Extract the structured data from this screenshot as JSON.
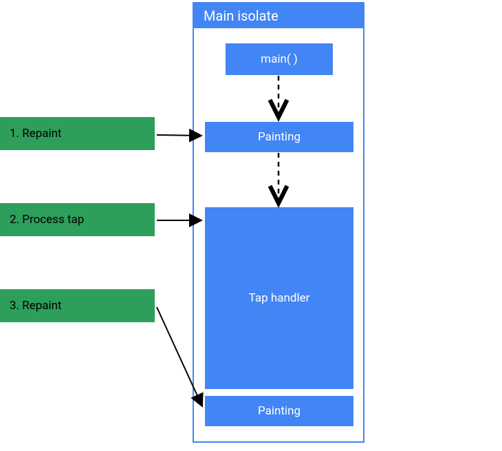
{
  "isolate": {
    "title": "Main isolate",
    "boxes": {
      "main": "main( )",
      "painting1": "Painting",
      "tap_handler": "Tap handler",
      "painting2": "Painting"
    }
  },
  "events": {
    "e1": "1. Repaint",
    "e2": "2. Process tap",
    "e3": "3. Repaint"
  },
  "colors": {
    "blue": "#4285f4",
    "green": "#2e9e5b"
  }
}
